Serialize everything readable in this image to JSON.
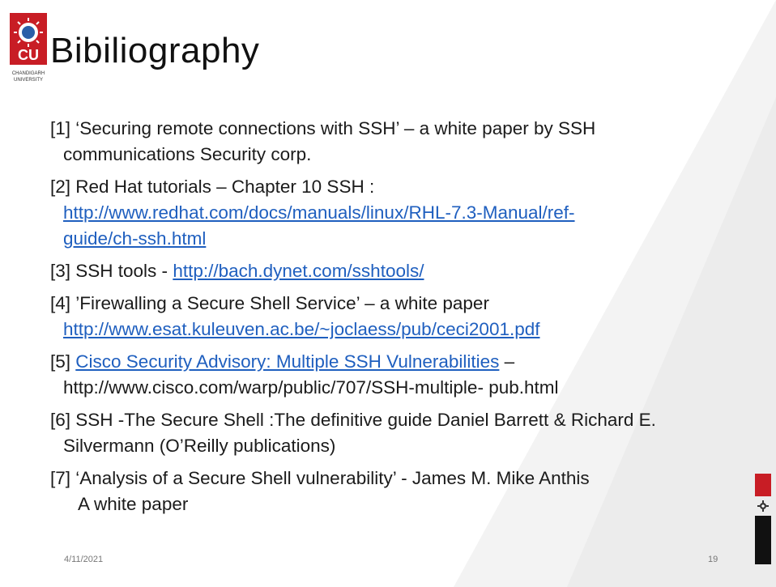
{
  "logo": {
    "abbr": "CU",
    "name_line1": "CHANDIGARH",
    "name_line2": "UNIVERSITY"
  },
  "title": "Bibiliography",
  "references": [
    {
      "lead": "[1] ‘Securing remote connections with SSH’ – a white paper by SSH",
      "cont": "communications Security corp."
    },
    {
      "lead": "[2] Red Hat tutorials – Chapter 10 SSH :",
      "link1": "http://www.redhat.com/docs/manuals/linux/RHL-7.3-Manual/ref-",
      "link2": "guide/ch-ssh.html"
    },
    {
      "lead": "[3] SSH tools - ",
      "link": "http://bach.dynet.com/sshtools/"
    },
    {
      "lead": "[4] ’Firewalling a Secure Shell Service’ – a white paper",
      "link": "http://www.esat.kuleuven.ac.be/~joclaess/pub/ceci2001.pdf"
    },
    {
      "lead": "[5] ",
      "link": "Cisco Security Advisory: Multiple SSH Vulnerabilities",
      "tail": " –",
      "cont": "http://www.cisco.com/warp/public/707/SSH-multiple- pub.html"
    },
    {
      "lead": "[6] SSH -The Secure Shell :The definitive guide Daniel Barrett & Richard E.",
      "cont": "Silvermann (O’Reilly publications)"
    },
    {
      "lead": "[7] ‘Analysis of a Secure Shell vulnerability’ -  James M. Mike Anthis",
      "cont": "A white paper"
    }
  ],
  "footer": {
    "date": "4/11/2021",
    "page": "19"
  },
  "colors": {
    "accent_red": "#c81d25",
    "link_blue": "#1f5fbf"
  }
}
